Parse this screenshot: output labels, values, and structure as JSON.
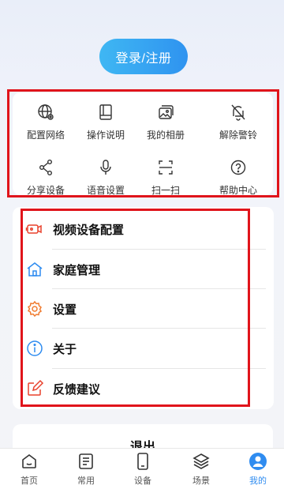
{
  "header": {
    "login_label": "登录/注册"
  },
  "quick_actions": [
    {
      "label": "配置网络",
      "icon": "globe-gear-icon"
    },
    {
      "label": "操作说明",
      "icon": "book-icon"
    },
    {
      "label": "我的相册",
      "icon": "album-icon"
    },
    {
      "label": "解除警铃",
      "icon": "bell-off-icon"
    },
    {
      "label": "分享设备",
      "icon": "share-icon"
    },
    {
      "label": "语音设置",
      "icon": "microphone-icon"
    },
    {
      "label": "扫一扫",
      "icon": "scan-icon"
    },
    {
      "label": "帮助中心",
      "icon": "help-icon"
    }
  ],
  "menu": [
    {
      "label": "视频设备配置",
      "icon": "video-device-icon",
      "color": "#e8412c"
    },
    {
      "label": "家庭管理",
      "icon": "home-icon",
      "color": "#2f8cf0"
    },
    {
      "label": "设置",
      "icon": "settings-gear-icon",
      "color": "#f07b2f"
    },
    {
      "label": "关于",
      "icon": "info-icon",
      "color": "#2f8cf0"
    },
    {
      "label": "反馈建议",
      "icon": "feedback-icon",
      "color": "#e8412c"
    }
  ],
  "logout_label": "退出",
  "tabs": [
    {
      "label": "首页",
      "icon": "home-tab-icon"
    },
    {
      "label": "常用",
      "icon": "list-tab-icon"
    },
    {
      "label": "设备",
      "icon": "device-tab-icon"
    },
    {
      "label": "场景",
      "icon": "layers-tab-icon"
    },
    {
      "label": "我的",
      "icon": "profile-tab-icon",
      "active": true
    }
  ],
  "colors": {
    "accent": "#2f8cf0",
    "highlight_box": "#e0141b"
  }
}
